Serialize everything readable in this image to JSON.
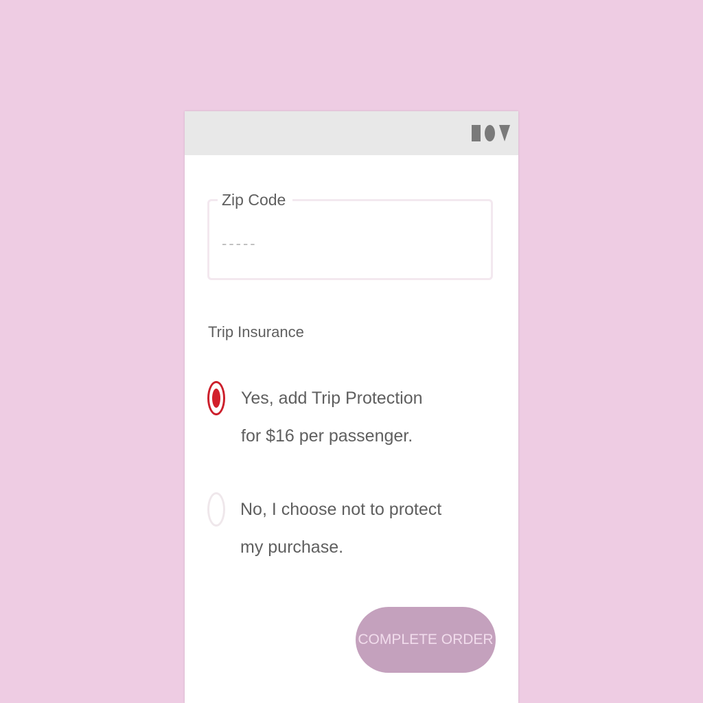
{
  "status_bar": {
    "icons": [
      "square-icon",
      "circle-icon",
      "triangle-icon"
    ]
  },
  "zip": {
    "label": "Zip Code",
    "placeholder": "-----",
    "value": ""
  },
  "trip_insurance": {
    "title": "Trip Insurance",
    "options": [
      {
        "label": "Yes, add Trip Protection for $16 per passenger.",
        "selected": true
      },
      {
        "label": "No, I choose not to protect my purchase.",
        "selected": false
      }
    ]
  },
  "complete_button": {
    "label": "COMPLETE ORDER"
  },
  "colors": {
    "background": "#eecce3",
    "accent_red": "#d21f2b",
    "button_bg": "#c4a1bd",
    "status_bar": "#e8e8e8"
  }
}
